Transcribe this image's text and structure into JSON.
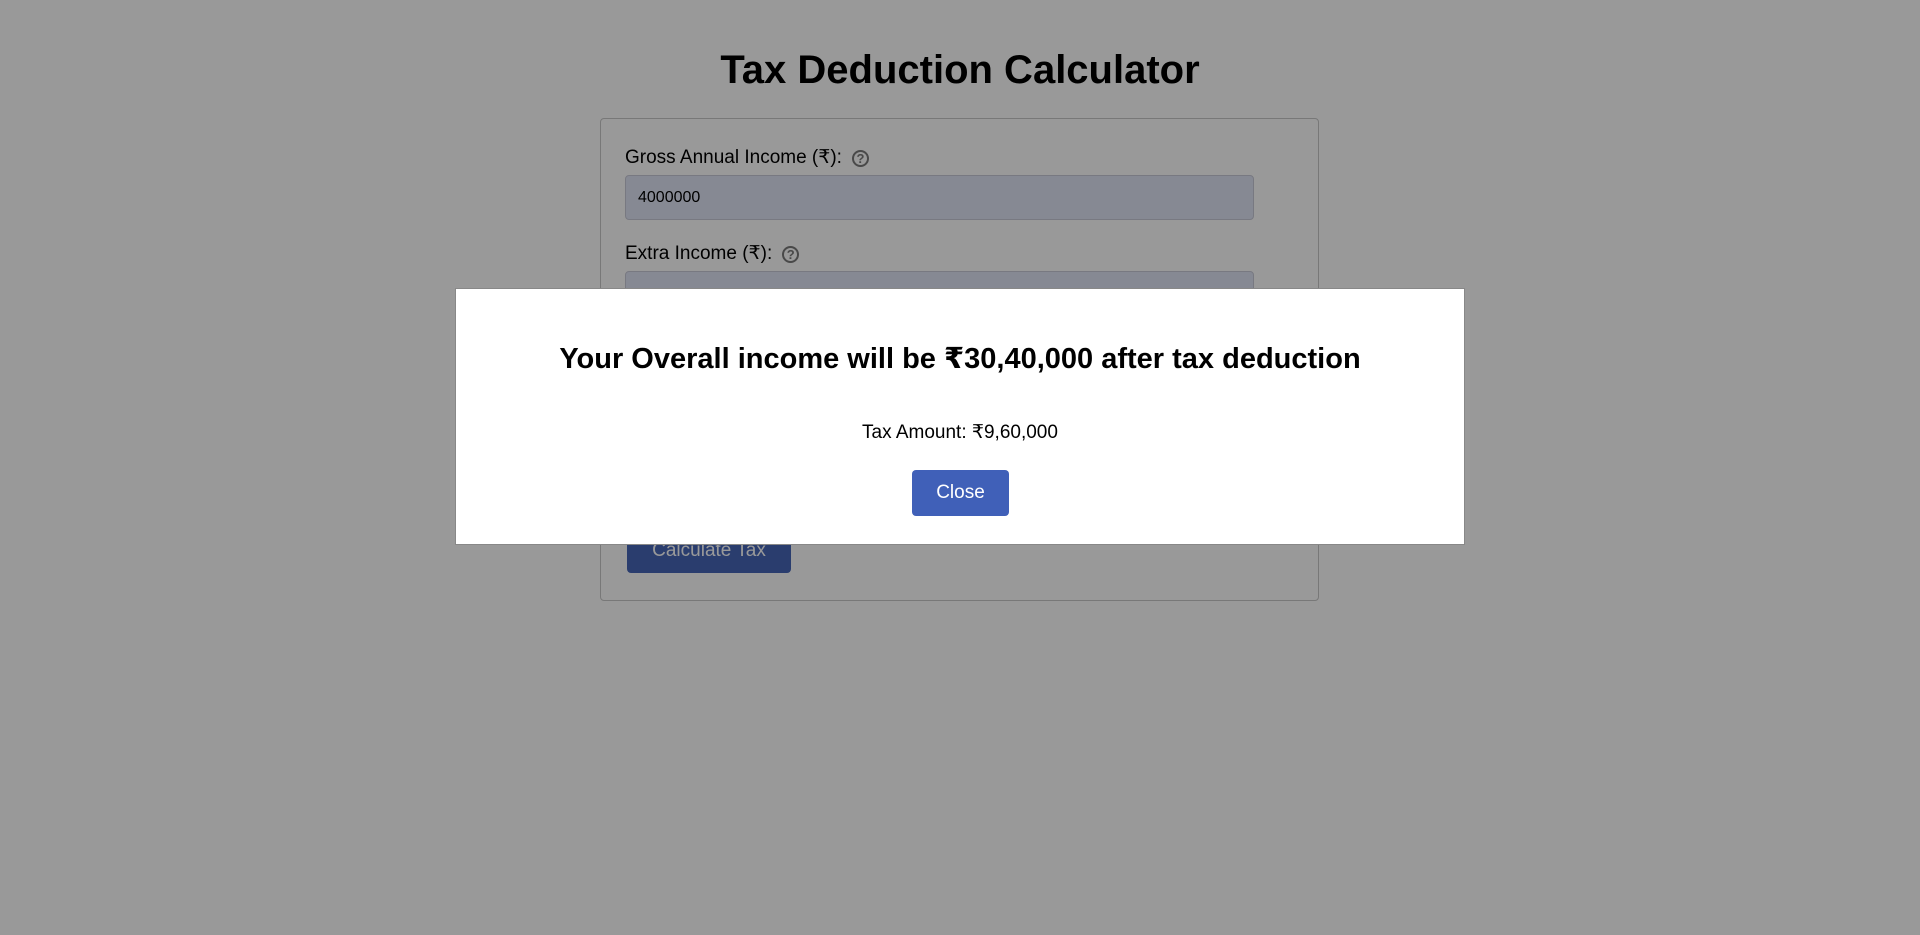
{
  "page": {
    "title": "Tax Deduction Calculator"
  },
  "form": {
    "gross_income": {
      "label": "Gross Annual Income (₹):",
      "value": "4000000",
      "help_icon": "question-circle-icon"
    },
    "extra_income": {
      "label": "Extra Income (₹):",
      "value": "",
      "help_icon": "question-circle-icon"
    },
    "calculate_label": "Calculate Tax"
  },
  "modal": {
    "heading": "Your Overall income will be ₹30,40,000 after tax deduction",
    "tax_amount": "Tax Amount: ₹9,60,000",
    "close_label": "Close"
  },
  "colors": {
    "accent": "#4060b8",
    "input_bg": "#e0e5f6",
    "overlay": "rgba(0,0,0,0.4)"
  }
}
